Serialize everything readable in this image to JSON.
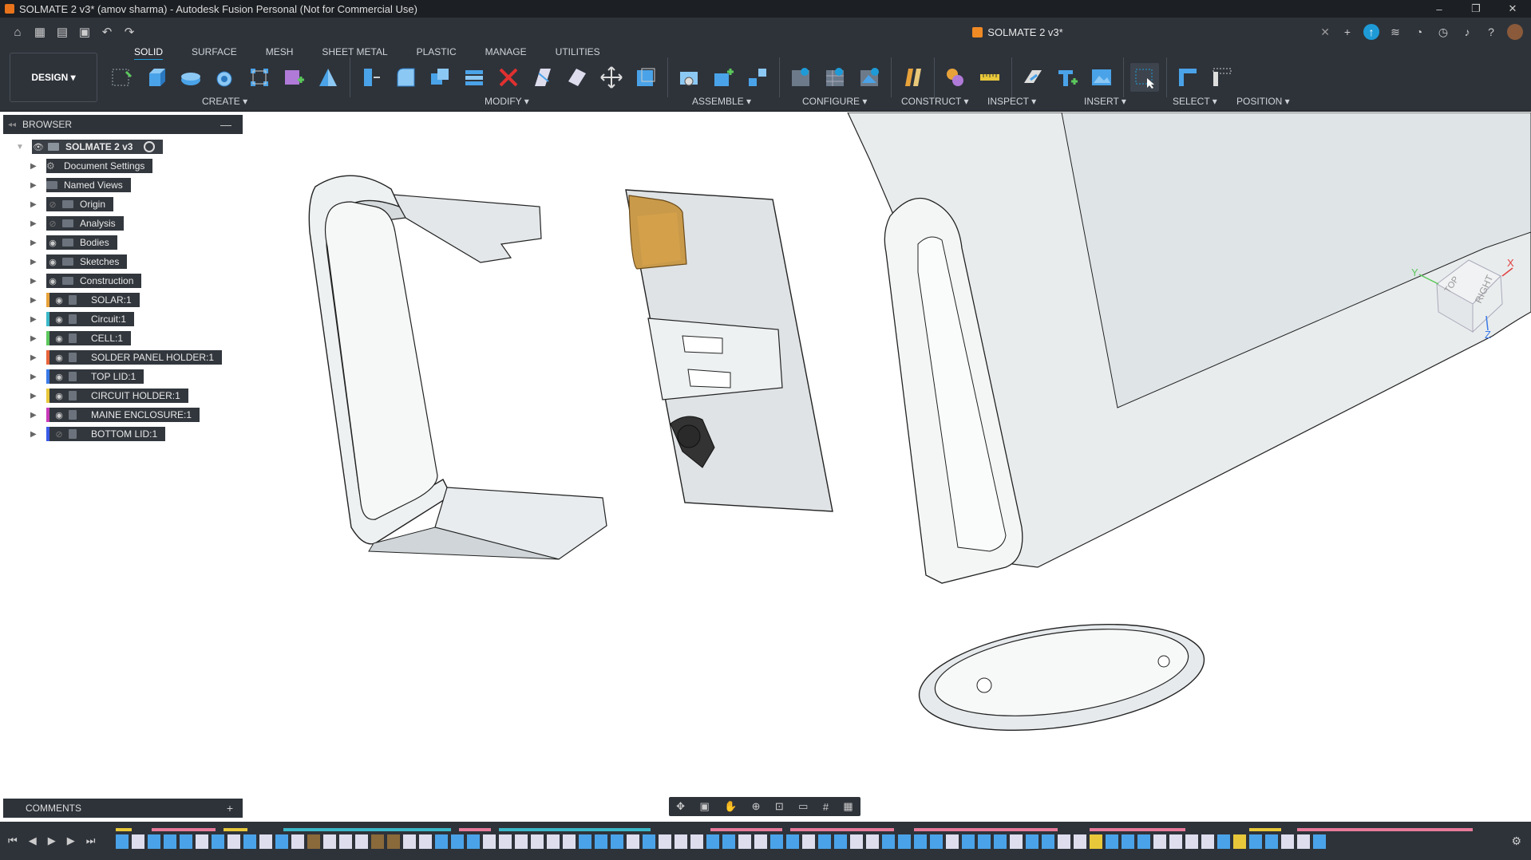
{
  "window": {
    "title": "SOLMATE 2 v3* (amov sharma) - Autodesk Fusion Personal (Not for Commercial Use)",
    "controls": [
      "–",
      "❐",
      "✕"
    ]
  },
  "doc_tab": {
    "label": "SOLMATE 2 v3*"
  },
  "ribbon": {
    "workspace": "DESIGN ▾",
    "tabs": [
      "SOLID",
      "SURFACE",
      "MESH",
      "SHEET METAL",
      "PLASTIC",
      "MANAGE",
      "UTILITIES"
    ],
    "active_tab": "SOLID",
    "groups": [
      "CREATE ▾",
      "MODIFY ▾",
      "ASSEMBLE ▾",
      "CONFIGURE ▾",
      "CONSTRUCT ▾",
      "INSPECT ▾",
      "INSERT ▾",
      "SELECT ▾",
      "POSITION ▾"
    ]
  },
  "browser": {
    "title": "BROWSER",
    "root": "SOLMATE 2 v3",
    "items": [
      {
        "label": "Document Settings",
        "type": "settings",
        "color": ""
      },
      {
        "label": "Named Views",
        "type": "folder",
        "color": ""
      },
      {
        "label": "Origin",
        "type": "folder",
        "color": "",
        "hidden": true
      },
      {
        "label": "Analysis",
        "type": "folder",
        "color": "",
        "hidden": true
      },
      {
        "label": "Bodies",
        "type": "folder",
        "color": ""
      },
      {
        "label": "Sketches",
        "type": "folder",
        "color": ""
      },
      {
        "label": "Construction",
        "type": "folder",
        "color": ""
      },
      {
        "label": "SOLAR:1",
        "type": "component",
        "color": "#e8a23a"
      },
      {
        "label": "Circuit:1",
        "type": "component",
        "color": "#3ab8c8"
      },
      {
        "label": "CELL:1",
        "type": "component",
        "color": "#5cc85c"
      },
      {
        "label": "SOLDER PANEL HOLDER:1",
        "type": "component",
        "color": "#e8643a"
      },
      {
        "label": "TOP LID:1",
        "type": "component",
        "color": "#3a7ae8"
      },
      {
        "label": "CIRCUIT HOLDER:1",
        "type": "component",
        "color": "#e8c83a"
      },
      {
        "label": "MAINE ENCLOSURE:1",
        "type": "component",
        "color": "#c83ab8"
      },
      {
        "label": "BOTTOM LID:1",
        "type": "component",
        "color": "#3a5ae8",
        "hidden": true
      }
    ]
  },
  "comments": {
    "title": "COMMENTS"
  },
  "viewcube": {
    "faces": [
      "TOP",
      "RIGHT"
    ],
    "axes": [
      "X",
      "Y",
      "Z"
    ]
  },
  "colors": {
    "accent": "#1e9bd7",
    "panel": "#2e333a",
    "titlebar": "#1c1f23",
    "part_gray": "#d7dbdd",
    "connector": "#d4a04a"
  }
}
